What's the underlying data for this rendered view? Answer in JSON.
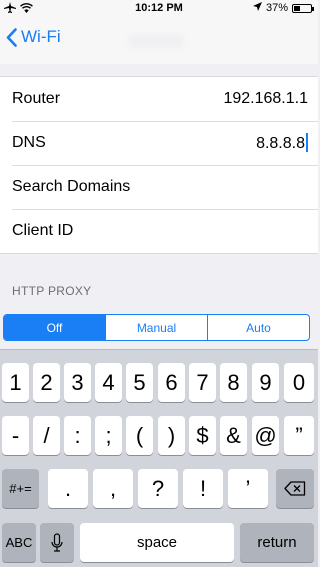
{
  "status_bar": {
    "time": "10:12 PM",
    "battery": "37%",
    "battery_level": 0.37
  },
  "nav": {
    "back_label": "Wi-Fi"
  },
  "rows": [
    {
      "label": "Router",
      "value": "192.168.1.1"
    },
    {
      "label": "DNS",
      "value": "8.8.8.8"
    },
    {
      "label": "Search Domains",
      "value": ""
    },
    {
      "label": "Client ID",
      "value": ""
    }
  ],
  "proxy": {
    "section_title": "HTTP PROXY",
    "options": [
      "Off",
      "Manual",
      "Auto"
    ],
    "selected": "Off"
  },
  "keyboard": {
    "row1": [
      "1",
      "2",
      "3",
      "4",
      "5",
      "6",
      "7",
      "8",
      "9",
      "0"
    ],
    "row2": [
      "-",
      "/",
      ":",
      ";",
      "(",
      ")",
      "$",
      "&",
      "@",
      "”"
    ],
    "row3": [
      ".",
      ",",
      "?",
      "!",
      "’"
    ],
    "mode_key": "#+=",
    "abc_key": "ABC",
    "space_key": "space",
    "return_key": "return"
  },
  "colors": {
    "accent": "#1a7ef5",
    "background": "#efeff4",
    "keyboard_bg": "#d1d5db"
  }
}
